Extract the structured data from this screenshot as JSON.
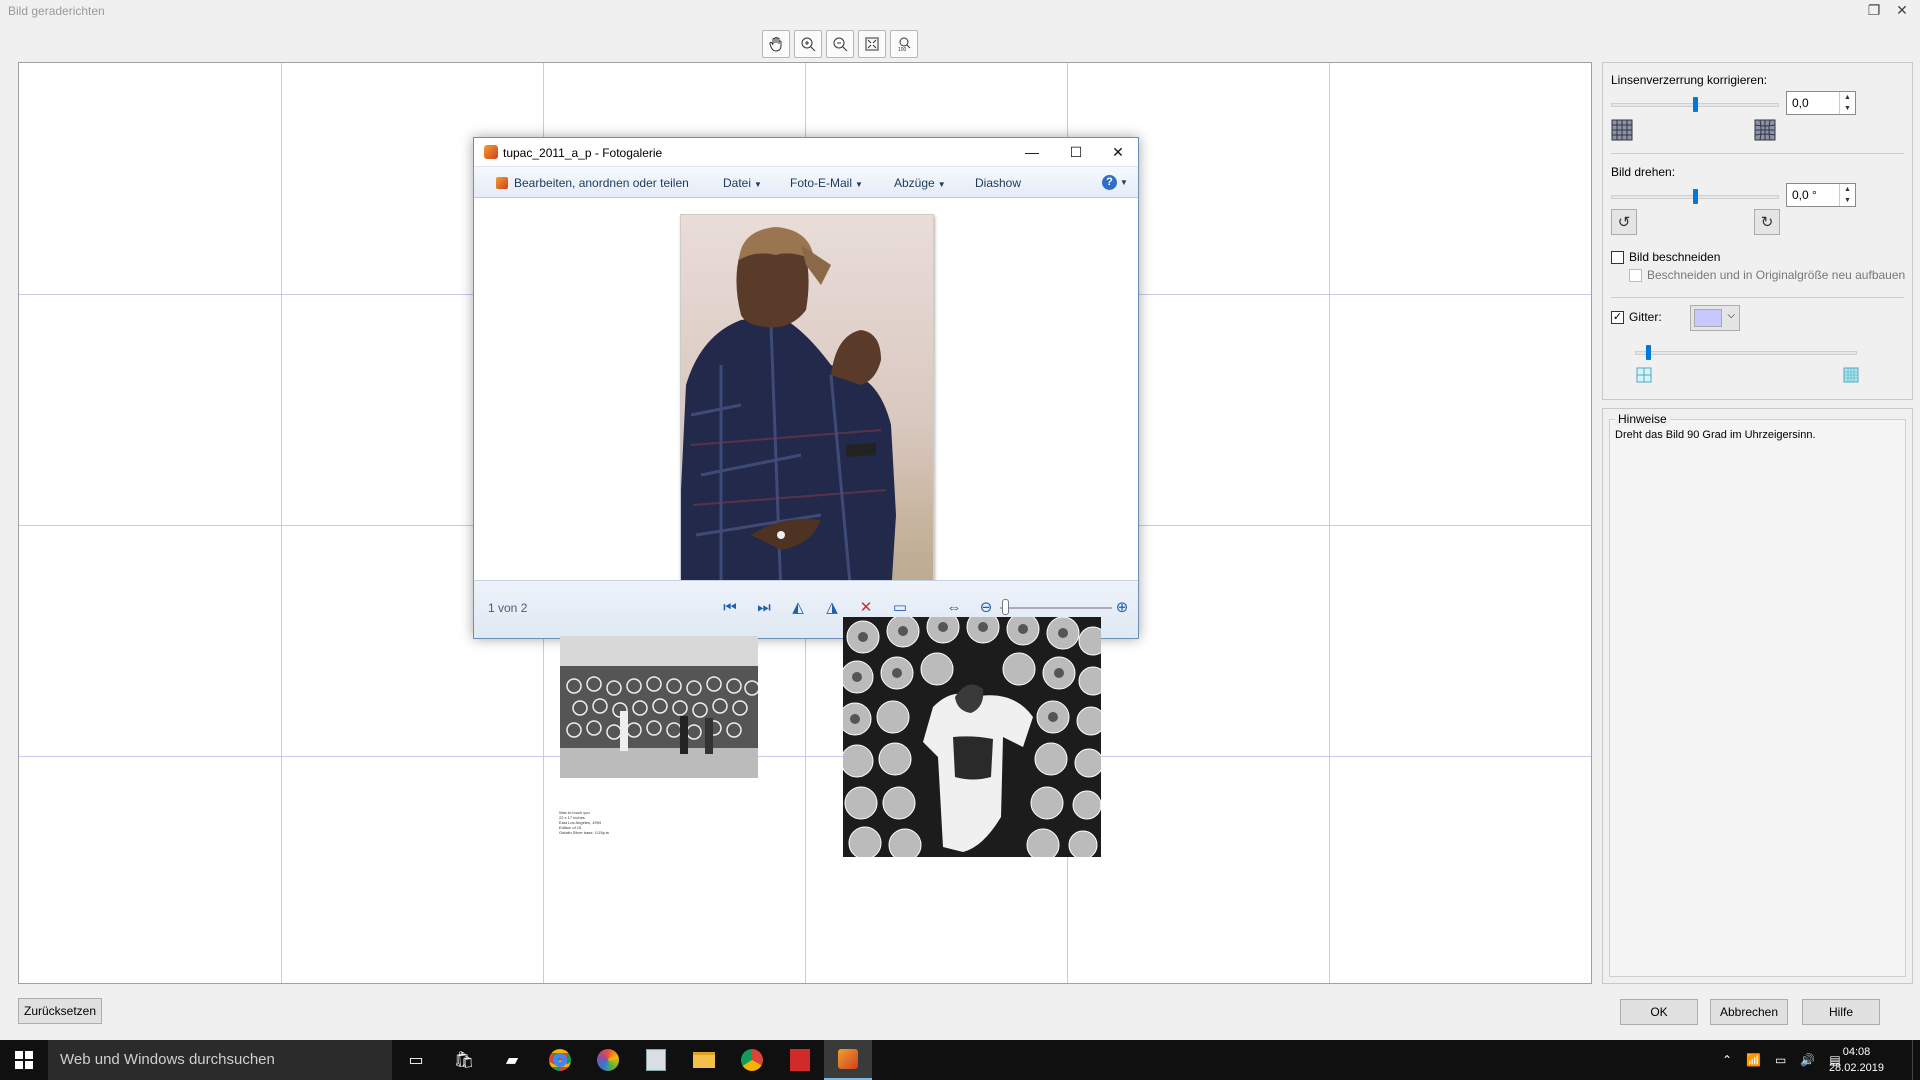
{
  "window": {
    "title": "Bild geraderichten"
  },
  "toolbar": {
    "tools": [
      "hand-icon",
      "zoom-in-icon",
      "zoom-out-icon",
      "fit-window-icon",
      "actual-size-icon"
    ]
  },
  "photo_gallery": {
    "title": "tupac_2011_a_p - Fotogalerie",
    "menu": {
      "edit": "Bearbeiten, anordnen oder teilen",
      "file": "Datei",
      "email": "Foto-E-Mail",
      "prints": "Abzüge",
      "slideshow": "Diashow"
    },
    "status": "1 von 2"
  },
  "caption_lines": [
    "Wax to touch you",
    "22 x 17 inches",
    "East Los Angeles, 1994",
    "Edition of 15",
    "Gelatin Silver base, 1/15p.ts"
  ],
  "right_panel": {
    "lens_label": "Linsenverzerrung korrigieren:",
    "lens_value": "0,0",
    "lens_level": 0.5,
    "rotate_label": "Bild drehen:",
    "rotate_value": "0,0 °",
    "rotate_level": 0.5,
    "crop_label": "Bild beschneiden",
    "crop_checked": false,
    "rebuild_label": "Beschneiden und in Originalgröße neu aufbauen",
    "grid_label": "Gitter:",
    "grid_checked": true,
    "grid_color": "#c8c8ff",
    "grid_density": 0.06
  },
  "hints": {
    "title": "Hinweise",
    "text": "Dreht das Bild 90 Grad im Uhrzeigersinn."
  },
  "buttons": {
    "reset": "Zurücksetzen",
    "ok": "OK",
    "cancel": "Abbrechen",
    "help": "Hilfe"
  },
  "taskbar": {
    "search_placeholder": "Web und Windows durchsuchen",
    "time": "04:08",
    "date": "28.02.2019"
  }
}
